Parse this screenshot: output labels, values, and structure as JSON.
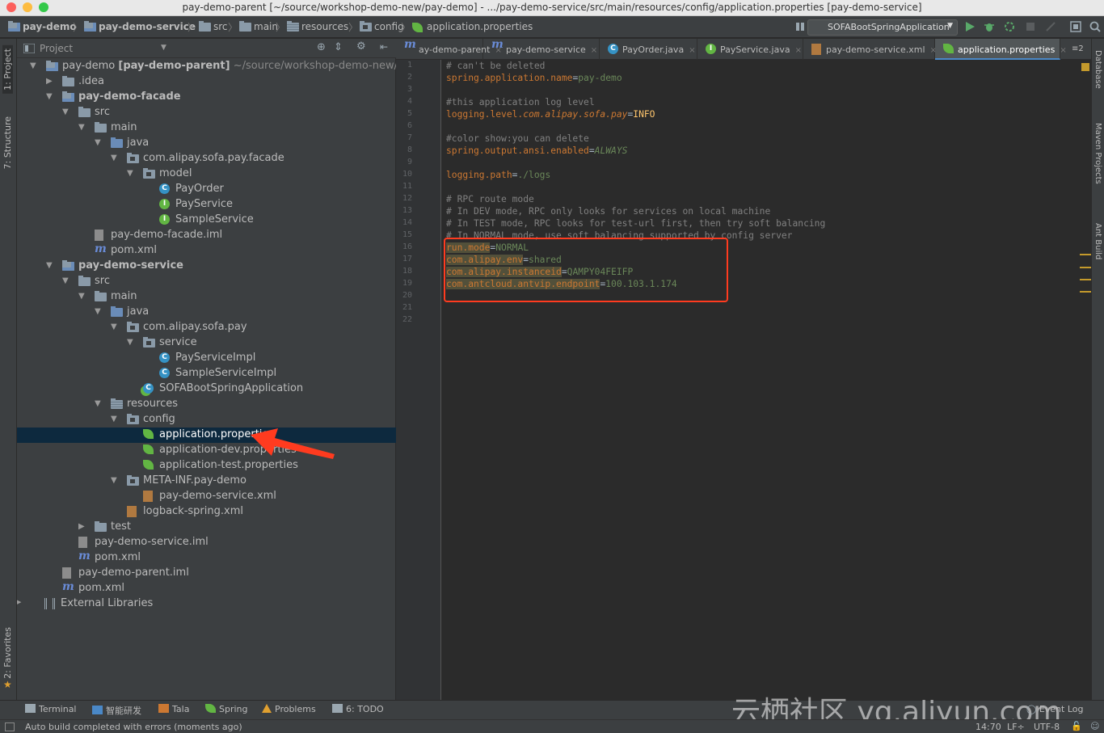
{
  "window": {
    "title": "pay-demo-parent [~/source/workshop-demo-new/pay-demo] - .../pay-demo-service/src/main/resources/config/application.properties [pay-demo-service]"
  },
  "breadcrumbs": [
    {
      "label": "pay-demo",
      "bold": true
    },
    {
      "label": "pay-demo-service",
      "bold": true
    },
    {
      "label": "src",
      "bold": false
    },
    {
      "label": "main",
      "bold": false
    },
    {
      "label": "resources",
      "bold": false
    },
    {
      "label": "config",
      "bold": false
    },
    {
      "label": "application.properties",
      "bold": false
    }
  ],
  "toolbar": {
    "run_config": "SOFABootSpringApplication"
  },
  "left_tool_tabs": {
    "project": "1: Project",
    "structure": "7: Structure",
    "favorites": "2: Favorites"
  },
  "right_tool_tabs": {
    "database": "Database",
    "maven": "Maven Projects",
    "ant": "Ant Build"
  },
  "project_panel": {
    "title": "Project",
    "tree": [
      {
        "label": "pay-demo [pay-demo-parent]",
        "suffix": "~/source/workshop-demo-new/pay-de",
        "icon": "module-folder",
        "expanded": true
      },
      {
        "label": ".idea",
        "icon": "folder",
        "expanded": false
      },
      {
        "label": "pay-demo-facade",
        "icon": "module-folder",
        "expanded": true
      },
      {
        "label": "src",
        "icon": "folder",
        "expanded": true
      },
      {
        "label": "main",
        "icon": "folder",
        "expanded": true
      },
      {
        "label": "java",
        "icon": "source-folder",
        "expanded": true
      },
      {
        "label": "com.alipay.sofa.pay.facade",
        "icon": "package",
        "expanded": true
      },
      {
        "label": "model",
        "icon": "package",
        "expanded": true
      },
      {
        "label": "PayOrder",
        "icon": "class"
      },
      {
        "label": "PayService",
        "icon": "interface"
      },
      {
        "label": "SampleService",
        "icon": "interface"
      },
      {
        "label": "pay-demo-facade.iml",
        "icon": "iml-file"
      },
      {
        "label": "pom.xml",
        "icon": "maven-file"
      },
      {
        "label": "pay-demo-service",
        "icon": "module-folder",
        "expanded": true
      },
      {
        "label": "src",
        "icon": "folder",
        "expanded": true
      },
      {
        "label": "main",
        "icon": "folder",
        "expanded": true
      },
      {
        "label": "java",
        "icon": "source-folder",
        "expanded": true
      },
      {
        "label": "com.alipay.sofa.pay",
        "icon": "package",
        "expanded": true
      },
      {
        "label": "service",
        "icon": "package",
        "expanded": true
      },
      {
        "label": "PayServiceImpl",
        "icon": "class"
      },
      {
        "label": "SampleServiceImpl",
        "icon": "class"
      },
      {
        "label": "SOFABootSpringApplication",
        "icon": "spring-class"
      },
      {
        "label": "resources",
        "icon": "resources-folder",
        "expanded": true
      },
      {
        "label": "config",
        "icon": "package",
        "expanded": true
      },
      {
        "label": "application.properties",
        "icon": "spring-properties",
        "selected": true
      },
      {
        "label": "application-dev.properties",
        "icon": "spring-properties"
      },
      {
        "label": "application-test.properties",
        "icon": "spring-properties"
      },
      {
        "label": "META-INF.pay-demo",
        "icon": "package",
        "expanded": true
      },
      {
        "label": "pay-demo-service.xml",
        "icon": "xml-file"
      },
      {
        "label": "logback-spring.xml",
        "icon": "xml-file"
      },
      {
        "label": "test",
        "icon": "folder",
        "expanded": false
      },
      {
        "label": "pay-demo-service.iml",
        "icon": "iml-file"
      },
      {
        "label": "pom.xml",
        "icon": "maven-file"
      },
      {
        "label": "pay-demo-parent.iml",
        "icon": "iml-file"
      },
      {
        "label": "pom.xml",
        "icon": "maven-file"
      },
      {
        "label": "External Libraries",
        "icon": "libraries",
        "expanded": false
      }
    ]
  },
  "editor_tabs": [
    {
      "label": "ay-demo-parent",
      "icon": "maven-file",
      "active": false
    },
    {
      "label": "pay-demo-service",
      "icon": "maven-file",
      "active": false
    },
    {
      "label": "PayOrder.java",
      "icon": "class",
      "active": false
    },
    {
      "label": "PayService.java",
      "icon": "interface",
      "active": false
    },
    {
      "label": "pay-demo-service.xml",
      "icon": "xml-file",
      "active": false
    },
    {
      "label": "application.properties",
      "icon": "spring-properties",
      "active": true
    }
  ],
  "editor_tab_overflow": "≡2",
  "code_lines": [
    [
      {
        "t": "# can't be deleted",
        "c": "cm"
      }
    ],
    [
      {
        "t": "spring.application.name",
        "c": "ky"
      },
      {
        "t": "=",
        "c": "eq"
      },
      {
        "t": "pay-demo",
        "c": "vl"
      }
    ],
    [],
    [
      {
        "t": "#this application log level",
        "c": "cm"
      }
    ],
    [
      {
        "t": "logging.level.",
        "c": "ky"
      },
      {
        "t": "com.alipay.sofa.pay",
        "c": "ky it"
      },
      {
        "t": "=",
        "c": "eq"
      },
      {
        "t": "INFO",
        "c": "yl"
      }
    ],
    [],
    [
      {
        "t": "#color show:you can delete",
        "c": "cm"
      }
    ],
    [
      {
        "t": "spring.output.ansi.enabled",
        "c": "ky"
      },
      {
        "t": "=",
        "c": "eq"
      },
      {
        "t": "ALWAYS",
        "c": "vl it"
      }
    ],
    [],
    [
      {
        "t": "logging.path",
        "c": "ky"
      },
      {
        "t": "=",
        "c": "eq"
      },
      {
        "t": "./logs",
        "c": "vl"
      }
    ],
    [],
    [
      {
        "t": "# RPC route mode",
        "c": "cm"
      }
    ],
    [
      {
        "t": "# In DEV mode, RPC only looks for services on local machine",
        "c": "cm"
      }
    ],
    [
      {
        "t": "# In TEST mode, RPC looks for test-url first, then try soft balancing",
        "c": "cm"
      }
    ],
    [
      {
        "t": "# In NORMAL mode, use soft balancing supported by config server",
        "c": "cm"
      }
    ],
    [
      {
        "t": "run.mode",
        "c": "ky hl"
      },
      {
        "t": "=",
        "c": "eq"
      },
      {
        "t": "NORMAL",
        "c": "vl"
      }
    ],
    [
      {
        "t": "com.alipay.env",
        "c": "ky hl"
      },
      {
        "t": "=",
        "c": "eq"
      },
      {
        "t": "shared",
        "c": "vl"
      }
    ],
    [
      {
        "t": "com.alipay.instanceid",
        "c": "ky hl"
      },
      {
        "t": "=",
        "c": "eq"
      },
      {
        "t": "QAMPY04FEIFP",
        "c": "vl"
      }
    ],
    [
      {
        "t": "com.antcloud.antvip.endpoint",
        "c": "ky hl"
      },
      {
        "t": "=",
        "c": "eq"
      },
      {
        "t": "100.103.1.174",
        "c": "vl"
      }
    ],
    [],
    [],
    []
  ],
  "bottom_tabs": [
    {
      "label": "Terminal",
      "icon": "terminal-icon"
    },
    {
      "label": "智能研发",
      "icon": "smart-dev-icon"
    },
    {
      "label": "Tala",
      "icon": "tala-icon"
    },
    {
      "label": "Spring",
      "icon": "spring-icon"
    },
    {
      "label": "Problems",
      "icon": "warning-icon"
    },
    {
      "label": "6: TODO",
      "icon": "todo-icon"
    }
  ],
  "event_log": "Event Log",
  "status": {
    "message": "Auto build completed with errors (moments ago)",
    "position": "14:70",
    "line_separator": "LF÷",
    "encoding": "UTF-8"
  },
  "watermark": "云栖社区 yq.aliyun.com",
  "colors": {
    "keyword": "#cc7832",
    "value": "#6a8759",
    "comment": "#808080",
    "annotation_box": "#ff3b1f"
  }
}
